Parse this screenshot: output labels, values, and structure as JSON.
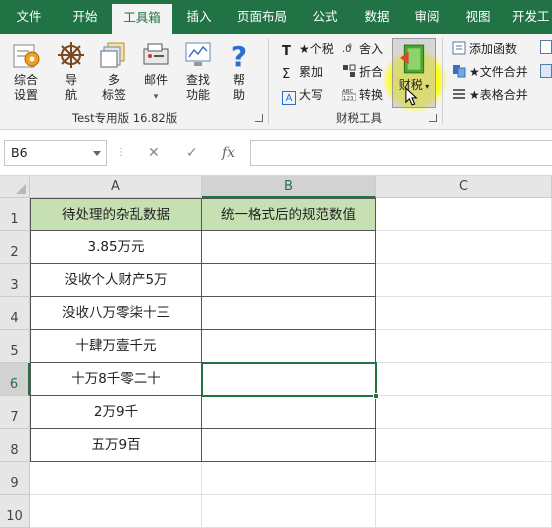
{
  "tabs": [
    "文件",
    "开始",
    "工具箱",
    "插入",
    "页面布局",
    "公式",
    "数据",
    "审阅",
    "视图",
    "开发工"
  ],
  "active_tab": "工具箱",
  "ribbon": {
    "group1": {
      "buttons": [
        {
          "label_lines": [
            "综合",
            "设置"
          ],
          "icon": "settings-icon"
        },
        {
          "label_lines": [
            "导",
            "航"
          ],
          "icon": "navigation-wheel-icon"
        },
        {
          "label_lines": [
            "多",
            "标签"
          ],
          "icon": "multi-tab-icon"
        },
        {
          "label_lines": [
            "邮件",
            "▾"
          ],
          "icon": "mail-icon"
        },
        {
          "label_lines": [
            "查找",
            "功能"
          ],
          "icon": "find-function-icon"
        },
        {
          "label_lines": [
            "帮",
            "助"
          ],
          "icon": "help-icon"
        }
      ],
      "label": "Test专用版 16.82版"
    },
    "group2": {
      "small_buttons": [
        {
          "text": "★个税",
          "icon": "T"
        },
        {
          "text": "累加",
          "icon": "Σ"
        },
        {
          "text": "大写",
          "icon": "A"
        },
        {
          "text": "舍入",
          "icon": "round-icon"
        },
        {
          "text": "折合",
          "icon": "convert-icon"
        },
        {
          "text": "转换",
          "icon": "ABC123"
        }
      ],
      "big_button": {
        "label": "财税",
        "icon": "finance-book-icon"
      },
      "label": "财税工具"
    },
    "group3": {
      "small_buttons": [
        {
          "text": "添加函数",
          "icon": "add-function-icon"
        },
        {
          "text": "★文件合并",
          "icon": "file-merge-icon"
        },
        {
          "text": "★表格合并",
          "icon": "table-merge-icon"
        }
      ]
    },
    "colors": {
      "tabbar": "#217346",
      "highlight": "#ffff00"
    }
  },
  "formula_bar": {
    "name_box": "B6",
    "cancel": "✕",
    "confirm": "✓",
    "fx": "fx",
    "formula": ""
  },
  "sheet": {
    "columns": [
      "A",
      "B",
      "C"
    ],
    "rows": [
      "1",
      "2",
      "3",
      "4",
      "5",
      "6",
      "7",
      "8",
      "9",
      "10"
    ],
    "selected_cell": "B6",
    "header": [
      "待处理的杂乱数据",
      "统一格式后的规范数值"
    ],
    "data": [
      "3.85万元",
      "没收个人财产5万",
      "没收八万零柒十三",
      "十肆万壹千元",
      "十万8千零二十",
      "2万9千",
      "五万9百"
    ]
  }
}
